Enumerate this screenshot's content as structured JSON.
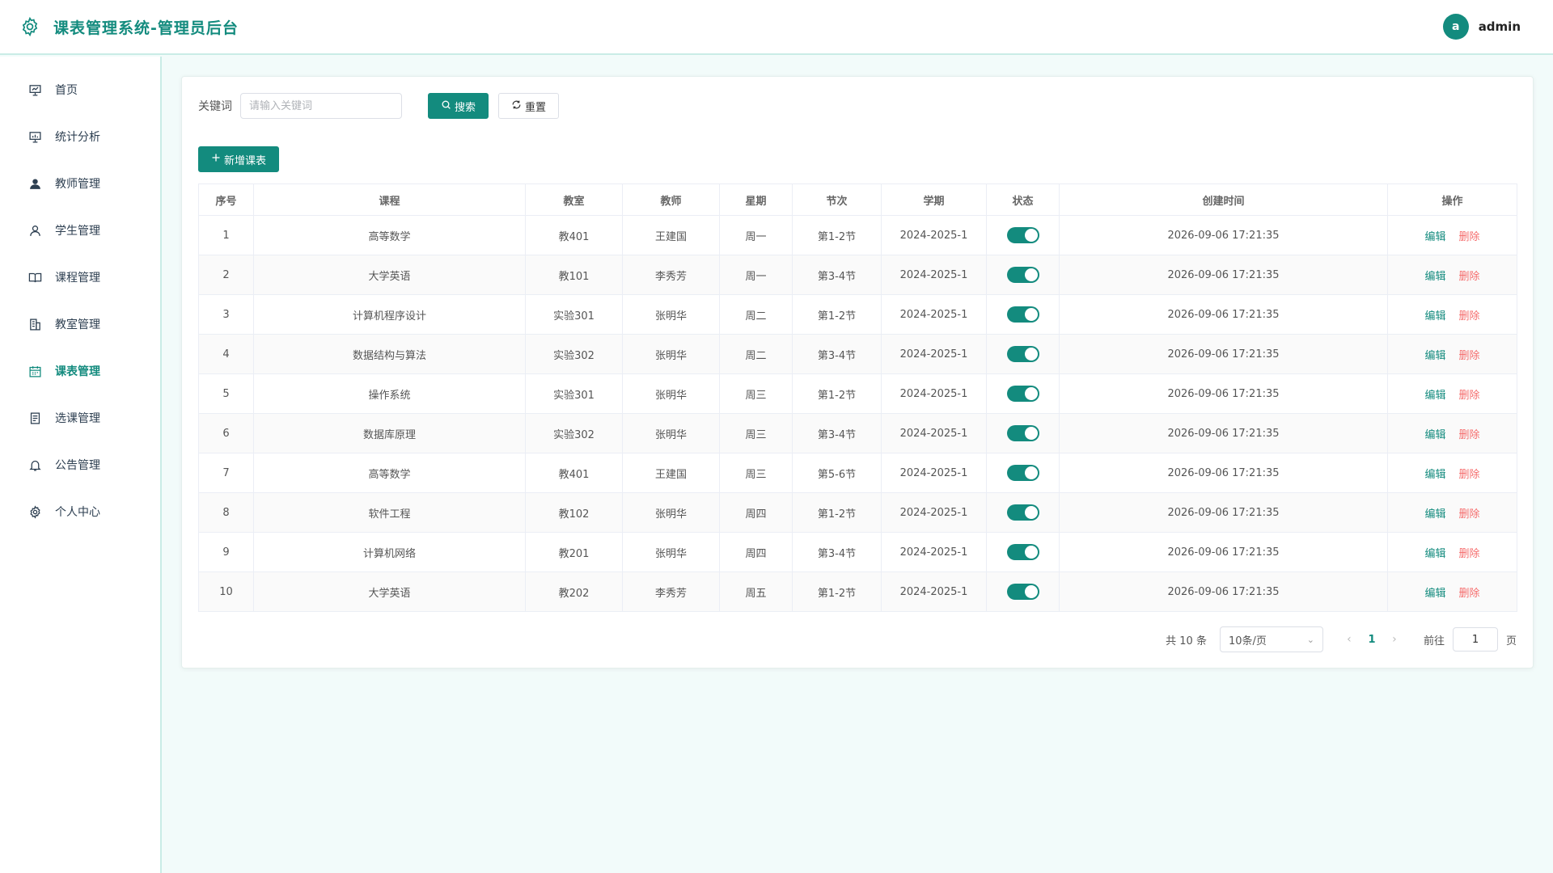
{
  "header": {
    "title": "课表管理系统-管理员后台",
    "avatar_letter": "a",
    "username": "admin"
  },
  "sidebar": {
    "items": [
      {
        "label": "首页",
        "icon": "presentation-board-icon",
        "active": false
      },
      {
        "label": "统计分析",
        "icon": "chart-board-icon",
        "active": false
      },
      {
        "label": "教师管理",
        "icon": "user-solid-icon",
        "active": false
      },
      {
        "label": "学生管理",
        "icon": "user-outline-icon",
        "active": false
      },
      {
        "label": "课程管理",
        "icon": "book-icon",
        "active": false
      },
      {
        "label": "教室管理",
        "icon": "building-icon",
        "active": false
      },
      {
        "label": "课表管理",
        "icon": "calendar-icon",
        "active": true
      },
      {
        "label": "选课管理",
        "icon": "document-icon",
        "active": false
      },
      {
        "label": "公告管理",
        "icon": "bell-icon",
        "active": false
      },
      {
        "label": "个人中心",
        "icon": "gear-icon",
        "active": false
      }
    ]
  },
  "search": {
    "label": "关键词",
    "placeholder": "请输入关键词",
    "search_label": "搜索",
    "reset_label": "重置"
  },
  "toolbar": {
    "add_label": "新增课表"
  },
  "table": {
    "columns": [
      "序号",
      "课程",
      "教室",
      "教师",
      "星期",
      "节次",
      "学期",
      "状态",
      "创建时间",
      "操作"
    ],
    "rows": [
      {
        "index": "1",
        "course": "高等数学",
        "room": "教401",
        "teacher": "王建国",
        "weekday": "周一",
        "period": "第1-2节",
        "term": "2024-2025-1",
        "status": true,
        "created": "2026-09-06 17:21:35"
      },
      {
        "index": "2",
        "course": "大学英语",
        "room": "教101",
        "teacher": "李秀芳",
        "weekday": "周一",
        "period": "第3-4节",
        "term": "2024-2025-1",
        "status": true,
        "created": "2026-09-06 17:21:35"
      },
      {
        "index": "3",
        "course": "计算机程序设计",
        "room": "实验301",
        "teacher": "张明华",
        "weekday": "周二",
        "period": "第1-2节",
        "term": "2024-2025-1",
        "status": true,
        "created": "2026-09-06 17:21:35"
      },
      {
        "index": "4",
        "course": "数据结构与算法",
        "room": "实验302",
        "teacher": "张明华",
        "weekday": "周二",
        "period": "第3-4节",
        "term": "2024-2025-1",
        "status": true,
        "created": "2026-09-06 17:21:35"
      },
      {
        "index": "5",
        "course": "操作系统",
        "room": "实验301",
        "teacher": "张明华",
        "weekday": "周三",
        "period": "第1-2节",
        "term": "2024-2025-1",
        "status": true,
        "created": "2026-09-06 17:21:35"
      },
      {
        "index": "6",
        "course": "数据库原理",
        "room": "实验302",
        "teacher": "张明华",
        "weekday": "周三",
        "period": "第3-4节",
        "term": "2024-2025-1",
        "status": true,
        "created": "2026-09-06 17:21:35"
      },
      {
        "index": "7",
        "course": "高等数学",
        "room": "教401",
        "teacher": "王建国",
        "weekday": "周三",
        "period": "第5-6节",
        "term": "2024-2025-1",
        "status": true,
        "created": "2026-09-06 17:21:35"
      },
      {
        "index": "8",
        "course": "软件工程",
        "room": "教102",
        "teacher": "张明华",
        "weekday": "周四",
        "period": "第1-2节",
        "term": "2024-2025-1",
        "status": true,
        "created": "2026-09-06 17:21:35"
      },
      {
        "index": "9",
        "course": "计算机网络",
        "room": "教201",
        "teacher": "张明华",
        "weekday": "周四",
        "period": "第3-4节",
        "term": "2024-2025-1",
        "status": true,
        "created": "2026-09-06 17:21:35"
      },
      {
        "index": "10",
        "course": "大学英语",
        "room": "教202",
        "teacher": "李秀芳",
        "weekday": "周五",
        "period": "第1-2节",
        "term": "2024-2025-1",
        "status": true,
        "created": "2026-09-06 17:21:35"
      }
    ],
    "edit_label": "编辑",
    "delete_label": "删除"
  },
  "pagination": {
    "total_text": "共 10 条",
    "page_size": "10条/页",
    "current_page": "1",
    "goto_label": "前往",
    "goto_value": "1",
    "page_unit": "页"
  },
  "colors": {
    "accent": "#138b7e",
    "danger": "#f56c6c",
    "background": "#f2fbfa"
  }
}
